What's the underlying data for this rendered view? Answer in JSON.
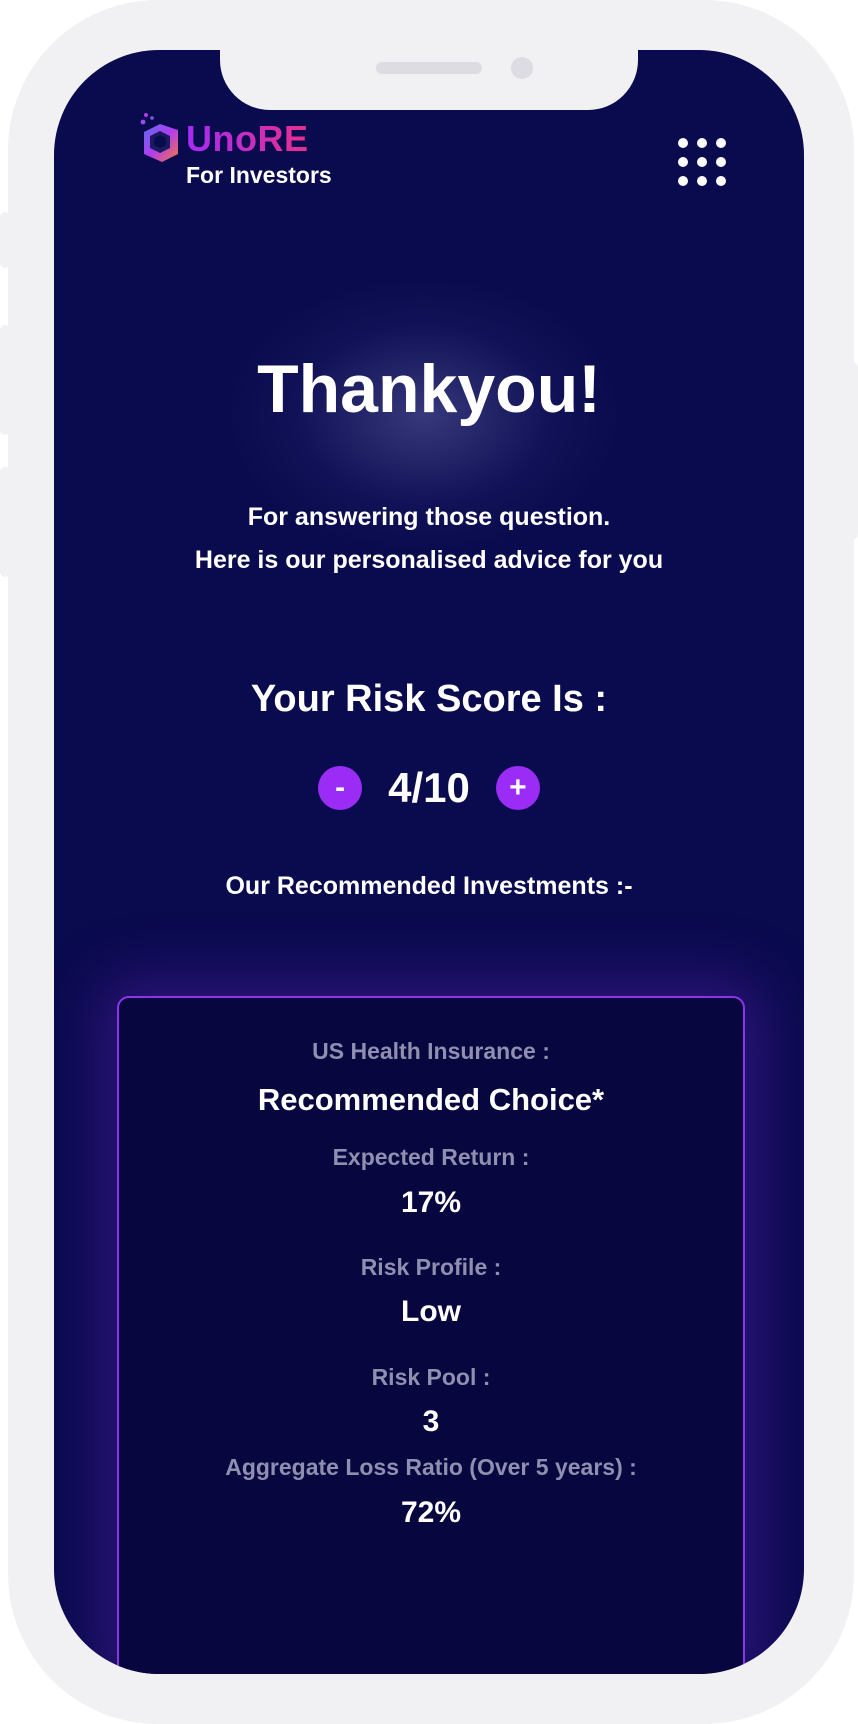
{
  "brand": {
    "name": "UnoRE",
    "tagline": "For Investors",
    "menu_icon": "grid-menu-icon",
    "colors": {
      "background": "#0a0a4e",
      "accent": "#9a2cf5",
      "brand_gradient": [
        "#a32cf5",
        "#e92f8c"
      ]
    }
  },
  "hero": {
    "title": "Thankyou!",
    "line1": "For answering those question.",
    "line2": "Here is our personalised advice for you"
  },
  "risk": {
    "heading": "Your Risk Score Is :",
    "decrement_label": "-",
    "increment_label": "+",
    "score": "4/10"
  },
  "recommendations": {
    "heading": "Our Recommended Investments :-",
    "card": {
      "category": "US Health Insurance :",
      "choice": "Recommended Choice*",
      "expected_return_label": "Expected Return :",
      "expected_return_value": "17%",
      "risk_profile_label": "Risk Profile :",
      "risk_profile_value": "Low",
      "risk_pool_label": "Risk Pool :",
      "risk_pool_value": "3",
      "loss_ratio_label": "Aggregate Loss Ratio (Over 5 years) :",
      "loss_ratio_value": "72%"
    }
  }
}
